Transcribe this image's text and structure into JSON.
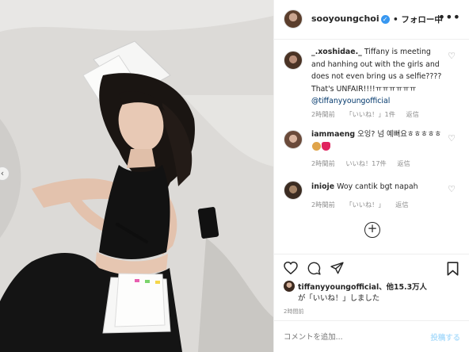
{
  "post": {
    "username": "sooyoungchoi",
    "follow_label": "• フォロー中",
    "more_label": "•••"
  },
  "comments": [
    {
      "username": "_.xoshidae._",
      "text": "Tiffany is meeting and hanhing out with the girls and does not even bring us a selfie???? That's UNFAIR!!!!ㅠㅠㅠㅠㅠㅠ",
      "mention": "@tiffanyyoungofficial",
      "time": "2時間前",
      "likes": "「いいね！」1件",
      "reply": "返信"
    },
    {
      "username": "iammaeng",
      "text": "오잉? 넘 예뻐요ㅎㅎㅎㅎㅎ",
      "time": "2時間前",
      "likes": "いいね！17件",
      "reply": "返信"
    },
    {
      "username": "inioje",
      "text": "Woy cantik bgt napah",
      "time": "2時間前",
      "likes": "「いいね！」",
      "reply": "返信"
    }
  ],
  "load_more_label": "+",
  "likes_summary": {
    "line1": "tiffanyyoungofficial、他15.3万人",
    "line2": "が「いいね！」しました"
  },
  "timestamp": "2時間前",
  "add_comment": {
    "placeholder": "コメントを追加...",
    "post_label": "投稿する"
  },
  "icons": {
    "verified": "verified-badge-icon",
    "heart": "heart-icon",
    "comment": "comment-icon",
    "share": "share-icon",
    "bookmark": "bookmark-icon",
    "add": "plus-circle-icon"
  },
  "colors": {
    "accent": "#3897f0",
    "link": "#00376b",
    "muted": "#8e8e8e",
    "post_button": "#b2dffc"
  }
}
